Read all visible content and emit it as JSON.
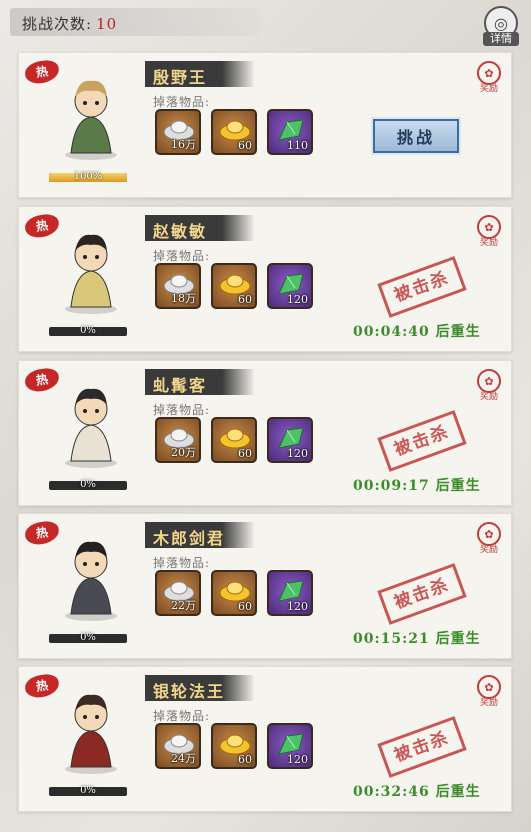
{
  "header": {
    "label": "挑战次数:",
    "count": "10"
  },
  "detail_button": {
    "label": "详情",
    "icon": "swirl-icon"
  },
  "drop_label": "掉落物品:",
  "challenge_label": "挑战",
  "killed_label": "被击杀",
  "reward_label": "奖励",
  "hot_label": "热",
  "bosses": [
    {
      "name": "殷野王",
      "hp_text": "100%",
      "hp": 1.0,
      "items": [
        "16万",
        "60",
        "110"
      ],
      "status": "alive",
      "respawn": ""
    },
    {
      "name": "赵敏敏",
      "hp_text": "0%",
      "hp": 0,
      "items": [
        "18万",
        "60",
        "120"
      ],
      "status": "killed",
      "respawn": "00:04:40 后重生"
    },
    {
      "name": "虬髯客",
      "hp_text": "0%",
      "hp": 0,
      "items": [
        "20万",
        "60",
        "120"
      ],
      "status": "killed",
      "respawn": "00:09:17 后重生"
    },
    {
      "name": "木郎剑君",
      "hp_text": "0%",
      "hp": 0,
      "items": [
        "22万",
        "60",
        "120"
      ],
      "status": "killed",
      "respawn": "00:15:21 后重生"
    },
    {
      "name": "银轮法王",
      "hp_text": "0%",
      "hp": 0,
      "items": [
        "24万",
        "60",
        "120"
      ],
      "status": "killed",
      "respawn": "00:32:46 后重生"
    }
  ],
  "colors": {
    "hot": "#c62828",
    "respawn": "#3b8c2a",
    "stamp": "#c23a3a",
    "gold_text": "#f0d68a"
  }
}
